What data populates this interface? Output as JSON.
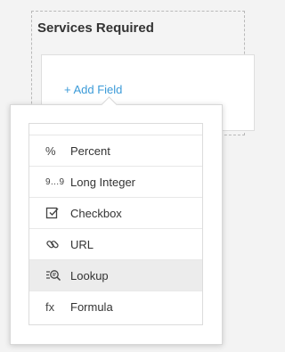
{
  "section": {
    "title": "Services Required"
  },
  "add_field": {
    "label": "+ Add Field"
  },
  "menu": {
    "items": [
      {
        "label": "Percent",
        "icon": "percent-icon",
        "glyph": "%"
      },
      {
        "label": "Long Integer",
        "icon": "long-integer-icon",
        "glyph": "9…9"
      },
      {
        "label": "Checkbox",
        "icon": "checkbox-icon"
      },
      {
        "label": "URL",
        "icon": "link-icon"
      },
      {
        "label": "Lookup",
        "icon": "lookup-icon",
        "active": true
      },
      {
        "label": "Formula",
        "icon": "formula-icon",
        "glyph": "fx"
      }
    ]
  }
}
